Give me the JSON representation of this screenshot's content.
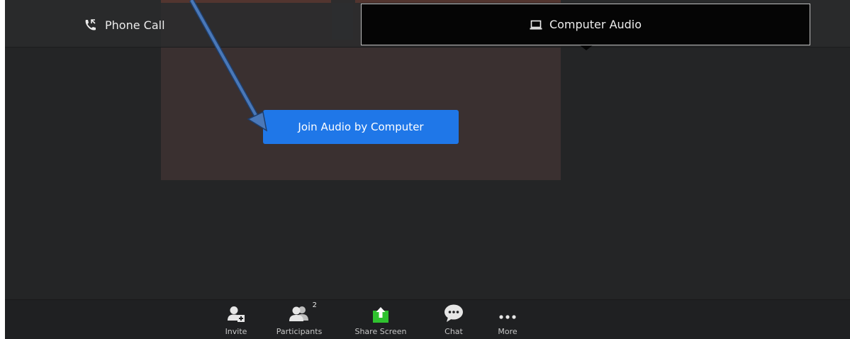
{
  "tabs": {
    "phone_call": "Phone Call",
    "computer_audio": "Computer Audio"
  },
  "join_button": "Join Audio by Computer",
  "toolbar": {
    "invite": "Invite",
    "participants": "Participants",
    "participants_count": "2",
    "share_screen": "Share Screen",
    "chat": "Chat",
    "more": "More"
  },
  "colors": {
    "background": "#242526",
    "join_button": "#1f77e8",
    "share_screen_icon": "#2fc22f",
    "annotation_arrow": "#4a78b8",
    "video_accent": "#e0573a"
  },
  "icons": {
    "phone_call": "phone-call-icon",
    "computer_audio": "laptop-icon",
    "invite": "invite-user-icon",
    "participants": "participants-icon",
    "share_screen": "share-screen-icon",
    "chat": "chat-bubble-icon",
    "more": "more-dots-icon"
  }
}
